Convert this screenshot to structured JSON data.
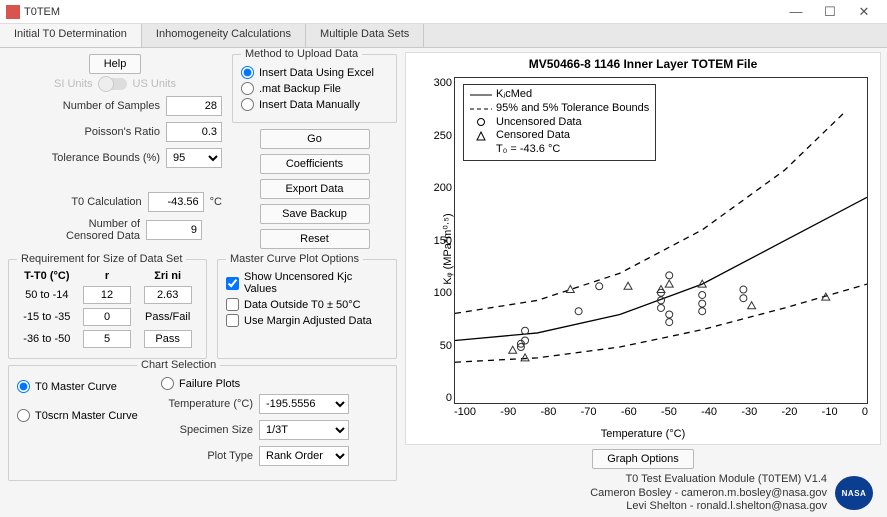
{
  "window": {
    "title": "T0TEM",
    "min": "—",
    "max": "☐",
    "close": "✕"
  },
  "tabs": [
    "Initial T0 Determination",
    "Inhomogeneity Calculations",
    "Multiple Data Sets"
  ],
  "help_label": "Help",
  "units": {
    "si": "SI Units",
    "us": "US Units"
  },
  "inputs": {
    "num_samples_label": "Number of Samples",
    "num_samples": "28",
    "poisson_label": "Poisson's Ratio",
    "poisson": "0.3",
    "tol_label": "Tolerance Bounds (%)",
    "tol": "95",
    "t0calc_label": "T0 Calculation",
    "t0calc": "-43.56",
    "t0calc_unit": "°C",
    "censored_label": "Number of Censored Data",
    "censored": "9"
  },
  "upload": {
    "legend": "Method to Upload Data",
    "opt_excel": "Insert Data Using Excel",
    "opt_mat": ".mat Backup File",
    "opt_manual": "Insert Data Manually",
    "go": "Go",
    "coeff": "Coefficients",
    "export": "Export Data",
    "save": "Save Backup",
    "reset": "Reset"
  },
  "req": {
    "legend": "Requirement for Size of Data Set",
    "h1": "T-T0 (°C)",
    "h2": "r",
    "h3": "Σri ni",
    "r1": {
      "range": "50 to -14",
      "r": "12",
      "s": "2.63"
    },
    "r2": {
      "range": "-15 to -35",
      "r": "0",
      "pf_label": "Pass/Fail"
    },
    "r3": {
      "range": "-36 to -50",
      "r": "5",
      "pf": "Pass"
    }
  },
  "mc_opts": {
    "legend": "Master Curve Plot Options",
    "show_unc": "Show Uncensored Kjc Values",
    "outside": "Data Outside T0 ± 50°C",
    "margin": "Use Margin Adjusted Data"
  },
  "chart_sel": {
    "legend": "Chart Selection",
    "t0mc": "T0 Master Curve",
    "failure": "Failure Plots",
    "t0scrn": "T0scrn Master Curve",
    "temp_label": "Temperature (°C)",
    "temp_val": "-195.5556",
    "size_label": "Specimen Size",
    "size_val": "1/3T",
    "ptype_label": "Plot Type",
    "ptype_val": "Rank Order"
  },
  "chart_data": {
    "type": "scatter",
    "title": "MV50466-8 1146 Inner Layer TOTEM File",
    "xlabel": "Temperature (°C)",
    "ylabel": "Kᵩ (MPa*m⁰·⁵)",
    "xlim": [
      -100,
      0
    ],
    "ylim": [
      0,
      300
    ],
    "xticks": [
      -100,
      -90,
      -80,
      -70,
      -60,
      -50,
      -40,
      -30,
      -20,
      -10,
      0
    ],
    "yticks": [
      0,
      50,
      100,
      150,
      200,
      250,
      300
    ],
    "legend": {
      "med": "KⱼcMed",
      "bounds": "95% and 5% Tolerance Bounds",
      "unc": "Uncensored Data",
      "cen": "Censored Data",
      "t0": "T₀ =   -43.6  °C"
    },
    "series": [
      {
        "name": "Uncensored",
        "marker": "circle",
        "points": [
          [
            -84,
            52
          ],
          [
            -84,
            55
          ],
          [
            -83,
            58
          ],
          [
            -83,
            67
          ],
          [
            -70,
            85
          ],
          [
            -65,
            108
          ],
          [
            -50,
            88
          ],
          [
            -50,
            95
          ],
          [
            -50,
            102
          ],
          [
            -48,
            75
          ],
          [
            -48,
            82
          ],
          [
            -48,
            118
          ],
          [
            -40,
            85
          ],
          [
            -40,
            92
          ],
          [
            -40,
            100
          ],
          [
            -30,
            97
          ],
          [
            -30,
            105
          ]
        ]
      },
      {
        "name": "Censored",
        "marker": "triangle",
        "points": [
          [
            -86,
            49
          ],
          [
            -83,
            42
          ],
          [
            -72,
            105
          ],
          [
            -58,
            108
          ],
          [
            -50,
            105
          ],
          [
            -48,
            110
          ],
          [
            -40,
            110
          ],
          [
            -28,
            90
          ],
          [
            -10,
            98
          ]
        ]
      }
    ],
    "curves": {
      "median": [
        [
          -100,
          58
        ],
        [
          -80,
          65
        ],
        [
          -60,
          82
        ],
        [
          -40,
          110
        ],
        [
          -20,
          150
        ],
        [
          0,
          190
        ]
      ],
      "upper": [
        [
          -100,
          83
        ],
        [
          -80,
          95
        ],
        [
          -60,
          120
        ],
        [
          -40,
          160
        ],
        [
          -20,
          215
        ],
        [
          -5,
          270
        ]
      ],
      "lower": [
        [
          -100,
          38
        ],
        [
          -80,
          42
        ],
        [
          -60,
          52
        ],
        [
          -40,
          68
        ],
        [
          -20,
          88
        ],
        [
          0,
          110
        ]
      ]
    }
  },
  "graph_options": "Graph Options",
  "footer": {
    "l1": "T0 Test Evaluation Module (T0TEM) V1.4",
    "l2": "Cameron Bosley - cameron.m.bosley@nasa.gov",
    "l3": "Levi Shelton - ronald.l.shelton@nasa.gov"
  }
}
